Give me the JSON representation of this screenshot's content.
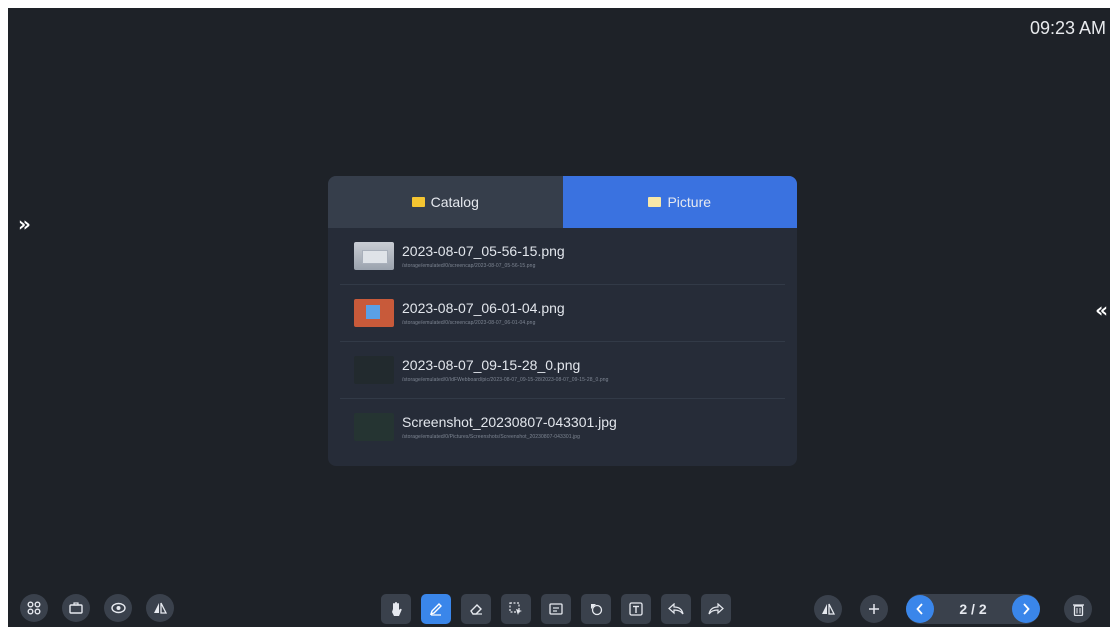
{
  "clock": "09:23 AM",
  "edges": {
    "left_arrow": "»",
    "right_arrow": "«"
  },
  "dialog": {
    "tabs": [
      {
        "label": "Catalog",
        "active": false
      },
      {
        "label": "Picture",
        "active": true
      }
    ],
    "files": [
      {
        "name": "2023-08-07_05-56-15.png",
        "path": "/storage/emulated/0/screencap/2023-08-07_05-56-15.png"
      },
      {
        "name": "2023-08-07_06-01-04.png",
        "path": "/storage/emulated/0/screencap/2023-08-07_06-01-04.png"
      },
      {
        "name": "2023-08-07_09-15-28_0.png",
        "path": "/storage/emulated/0/IdFWebboard/pic/2023-08-07_09-15-28/2023-08-07_09-15-28_0.png"
      },
      {
        "name": "Screenshot_20230807-043301.jpg",
        "path": "/storage/emulated/0/Pictures/Screenshots/Screenshot_20230807-043301.jpg"
      }
    ]
  },
  "toolbar": {
    "left_icons": [
      "apps-icon",
      "toolbox-icon",
      "eye-icon",
      "mirror-icon"
    ],
    "center_icons": [
      "hand-icon",
      "pen-icon",
      "eraser-icon",
      "select-icon",
      "insert-icon",
      "shape-icon",
      "text-icon",
      "undo-icon",
      "redo-icon"
    ],
    "active_tool": "pen-icon",
    "right_icons": [
      "mirror-icon",
      "add-page-icon"
    ],
    "page_indicator": "2 / 2"
  },
  "colors": {
    "accent": "#3a72e0",
    "background": "#1e2228",
    "panel": "#262c38"
  }
}
